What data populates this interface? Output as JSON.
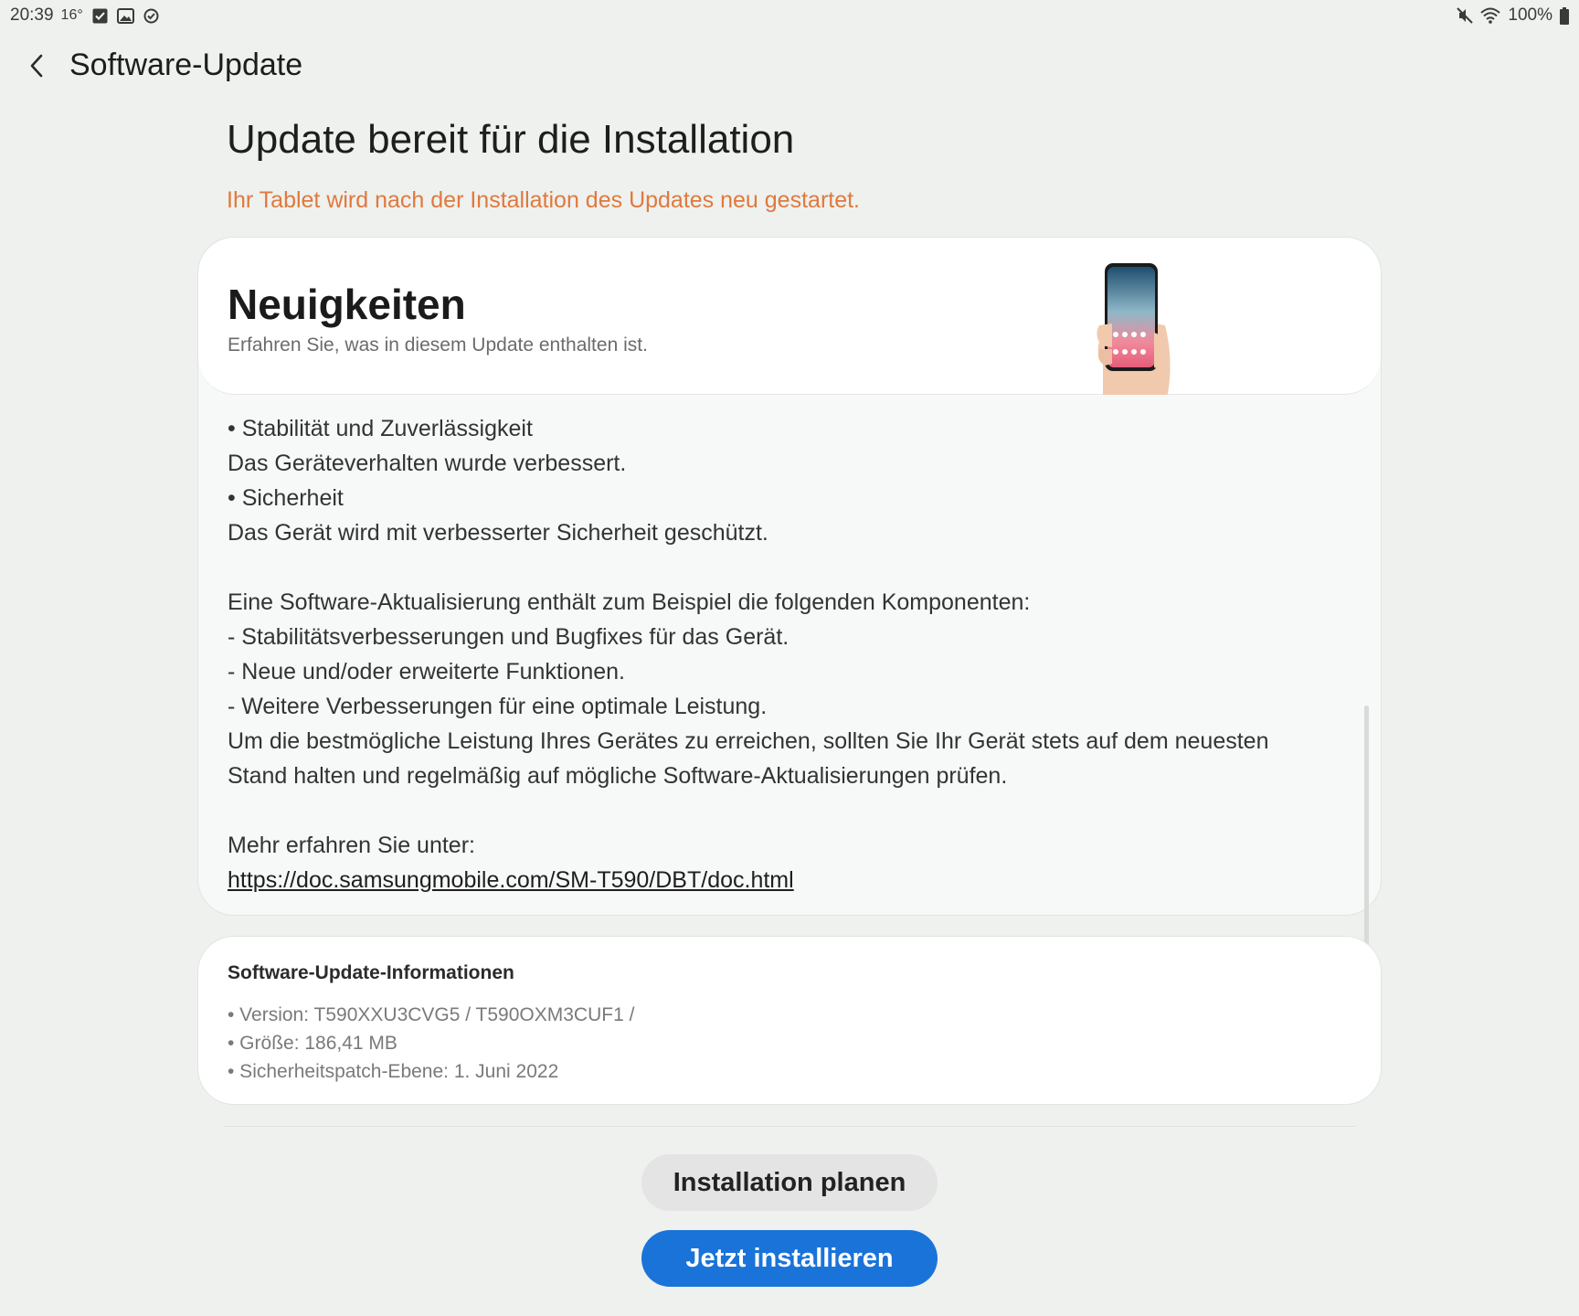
{
  "status_bar": {
    "time": "20:39",
    "temperature": "16°",
    "battery": "100%",
    "left_icons": [
      "checkbox-icon",
      "gallery-icon",
      "check-circle-icon"
    ],
    "right_icons": [
      "mute-icon",
      "wifi-icon",
      "battery-icon"
    ]
  },
  "appbar": {
    "title": "Software-Update",
    "back_icon": "chevron-left-icon"
  },
  "header": {
    "heading": "Update bereit für die Installation",
    "warning": "Ihr Tablet wird nach der Installation des Updates neu gestartet.",
    "warning_color": "#e0793d"
  },
  "news": {
    "title": "Neuigkeiten",
    "subtitle": "Erfahren Sie, was in diesem Update enthalten ist.",
    "illustration": "phone-in-hand-illustration",
    "lines": [
      "• Stabilität und Zuverlässigkeit",
      "Das Geräteverhalten wurde verbessert.",
      "• Sicherheit",
      "Das Gerät wird mit verbesserter Sicherheit geschützt.",
      "",
      "Eine Software-Aktualisierung enthält zum Beispiel die folgenden Komponenten:",
      " - Stabilitätsverbesserungen und Bugfixes für das Gerät.",
      " - Neue und/oder erweiterte Funktionen.",
      " - Weitere Verbesserungen für eine optimale Leistung.",
      "Um die bestmögliche Leistung Ihres Gerätes zu erreichen, sollten Sie Ihr Gerät stets auf dem neuesten",
      "Stand halten und regelmäßig auf mögliche Software-Aktualisierungen prüfen.",
      "",
      "Mehr erfahren Sie unter:"
    ],
    "link": "https://doc.samsungmobile.com/SM-T590/DBT/doc.html"
  },
  "info": {
    "title": "Software-Update-Informationen",
    "version": "• Version: T590XXU3CVG5 / T590OXM3CUF1 /",
    "size": "• Größe: 186,41 MB",
    "patch": "• Sicherheitspatch-Ebene: 1. Juni 2022"
  },
  "buttons": {
    "schedule": "Installation planen",
    "install": "Jetzt installieren",
    "install_color": "#1a73d9"
  }
}
